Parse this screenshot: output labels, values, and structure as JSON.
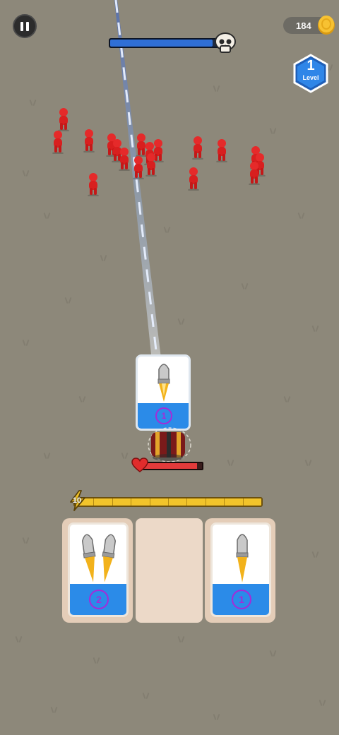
{
  "hud": {
    "coins": "184",
    "level_number": "1",
    "level_label": "Level",
    "boss_progress": 0.93
  },
  "player": {
    "health": 0.92,
    "energy_value": "10",
    "energy_fill": 1.0,
    "loaded_card_count": "1"
  },
  "hand": {
    "cards": [
      {
        "count": "2",
        "bullets": 2
      },
      {
        "empty": true
      },
      {
        "count": "1",
        "bullets": 1
      }
    ]
  },
  "icons": {
    "pause": "pause-icon",
    "skull": "skull-icon",
    "coin": "coin-icon",
    "level": "hexagon-badge-icon",
    "heart": "heart-icon",
    "energy": "lightning-bolt-icon",
    "bullet": "bullet-icon"
  },
  "colors": {
    "ground": "#8d887a",
    "enemy": "#e52a2a",
    "card_blue": "#2b8be8",
    "count_purple": "#a52ad8",
    "energy_yellow": "#f2c42b"
  }
}
